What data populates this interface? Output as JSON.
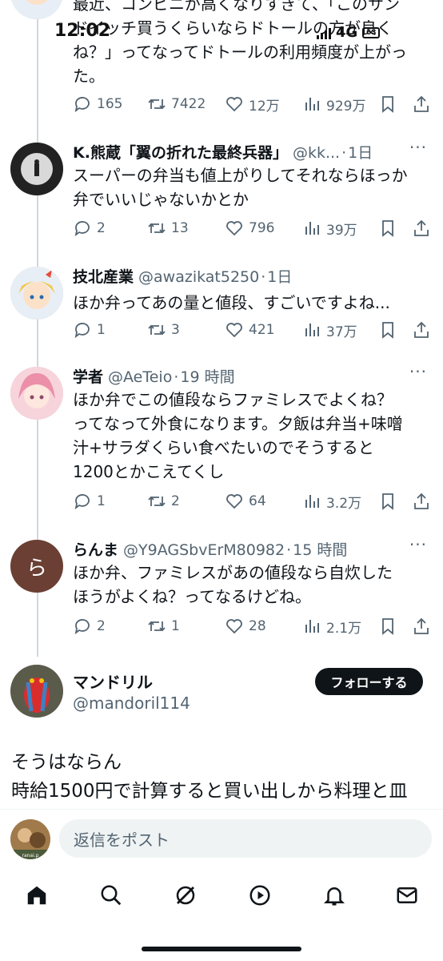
{
  "status_bar": {
    "time": "12:02",
    "network": "4G",
    "battery": "63"
  },
  "top_tweet": {
    "text": "最近、コンビニが高くなりすぎて、「このサン\nドイッチ買うくらいならドトールの方が良く\nね？」ってなってドトールの利用頻度が上がっ\nた。",
    "replies": "165",
    "retweets": "7422",
    "likes": "12万",
    "views": "929万"
  },
  "replies": [
    {
      "name": "K.熊蔵「翼の折れた最終兵器」",
      "handle": "@kk...",
      "time": "1日",
      "text": "スーパーの弁当も値上がりしてそれならほっか\n弁でいいじゃないかとか",
      "replies": "2",
      "retweets": "13",
      "likes": "796",
      "views": "39万"
    },
    {
      "name": "技北産業",
      "handle": "@awazikat5250",
      "time": "1日",
      "text": "ほか弁ってあの量と値段、すごいですよね...",
      "replies": "1",
      "retweets": "3",
      "likes": "421",
      "views": "37万"
    },
    {
      "name": "学者",
      "handle": "@AeTeio",
      "time": "19 時間",
      "text": "ほか弁でこの値段ならファミレスでよくね？\nってなって外食になります。夕飯は弁当+味噌\n汁+サラダくらい食べたいのでそうすると\n1200とかこえてくし",
      "replies": "1",
      "retweets": "2",
      "likes": "64",
      "views": "3.2万"
    },
    {
      "name": "らんま",
      "handle": "@Y9AGSbvErM80982",
      "time": "15 時間",
      "avatar_letter": "ら",
      "text": "ほか弁、ファミレスがあの値段なら自炊した\nほうがよくね？ってなるけどね。",
      "replies": "2",
      "retweets": "1",
      "likes": "28",
      "views": "2.1万"
    }
  ],
  "main_post": {
    "name": "マンドリル",
    "handle": "@mandoril114",
    "follow_label": "フォローする",
    "text": "そうはならん\n時給1500円で計算すると買い出しから料理と皿"
  },
  "reply_bar": {
    "placeholder": "返信をポスト",
    "avatar_caption": "ranai.p"
  },
  "nav": [
    "home-icon",
    "search-icon",
    "grok-icon",
    "video-icon",
    "notifications-icon",
    "messages-icon"
  ],
  "colors": {
    "text": "#0f1419",
    "secondary": "#536471",
    "thread": "#cfd9de",
    "input_bg": "#eff3f4"
  }
}
